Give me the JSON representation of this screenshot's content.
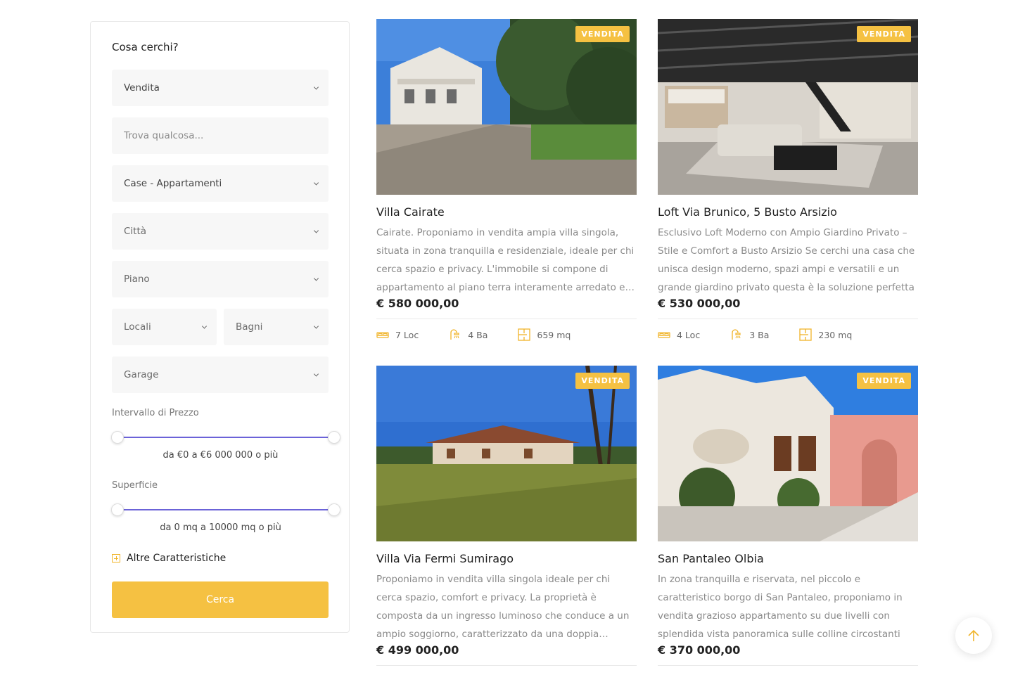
{
  "search": {
    "title": "Cosa cerchi?",
    "contract": "Vendita",
    "keyword_placeholder": "Trova qualcosa...",
    "type": "Case - Appartamenti",
    "city": "Città",
    "floor": "Piano",
    "rooms": "Locali",
    "baths": "Bagni",
    "garage": "Garage",
    "price_label": "Intervallo di Prezzo",
    "price_range_text": "da €0 a €6 000 000 o più",
    "price_range": [
      0,
      6000000
    ],
    "area_label": "Superficie",
    "area_range_text": "da 0 mq a 10000 mq o più",
    "area_range": [
      0,
      10000
    ],
    "more_label": "Altre Caratteristiche",
    "submit_label": "Cerca"
  },
  "colors": {
    "accent": "#f5c142",
    "slider": "#6b63d8"
  },
  "listings": [
    {
      "badge": "VENDITA",
      "title": "Villa Cairate",
      "description": "Cairate. Proponiamo in vendita ampia villa singola, situata in zona tranquilla e residenziale, ideale per chi cerca spazio e privacy. L'immobile si compone di appartamento al piano terra interamente arredato e predisposto",
      "price": "€ 580 000,00",
      "rooms": "7 Loc",
      "baths": "4 Ba",
      "area": "659 mq"
    },
    {
      "badge": "VENDITA",
      "title": "Loft Via Brunico, 5 Busto Arsizio",
      "description": "Esclusivo Loft Moderno con Ampio Giardino Privato – Stile e Comfort a Busto Arsizio Se cerchi una casa che unisca design moderno, spazi ampi e versatili e un grande giardino privato questa è la soluzione perfetta",
      "price": "€ 530 000,00",
      "rooms": "4 Loc",
      "baths": "3 Ba",
      "area": "230 mq"
    },
    {
      "badge": "VENDITA",
      "title": "Villa Via Fermi Sumirago",
      "description": "Proponiamo in vendita villa singola ideale per chi cerca spazio, comfort e privacy. La proprietà è composta da un ingresso luminoso che conduce a un ampio soggiorno, caratterizzato da una doppia esposizione",
      "price": "€ 499 000,00"
    },
    {
      "badge": "VENDITA",
      "title": "San Pantaleo Olbia",
      "description": "In zona tranquilla e riservata, nel piccolo e caratteristico borgo di San Pantaleo, proponiamo in vendita grazioso appartamento su due livelli con splendida vista panoramica sulle colline circostanti",
      "price": "€ 370 000,00"
    }
  ]
}
